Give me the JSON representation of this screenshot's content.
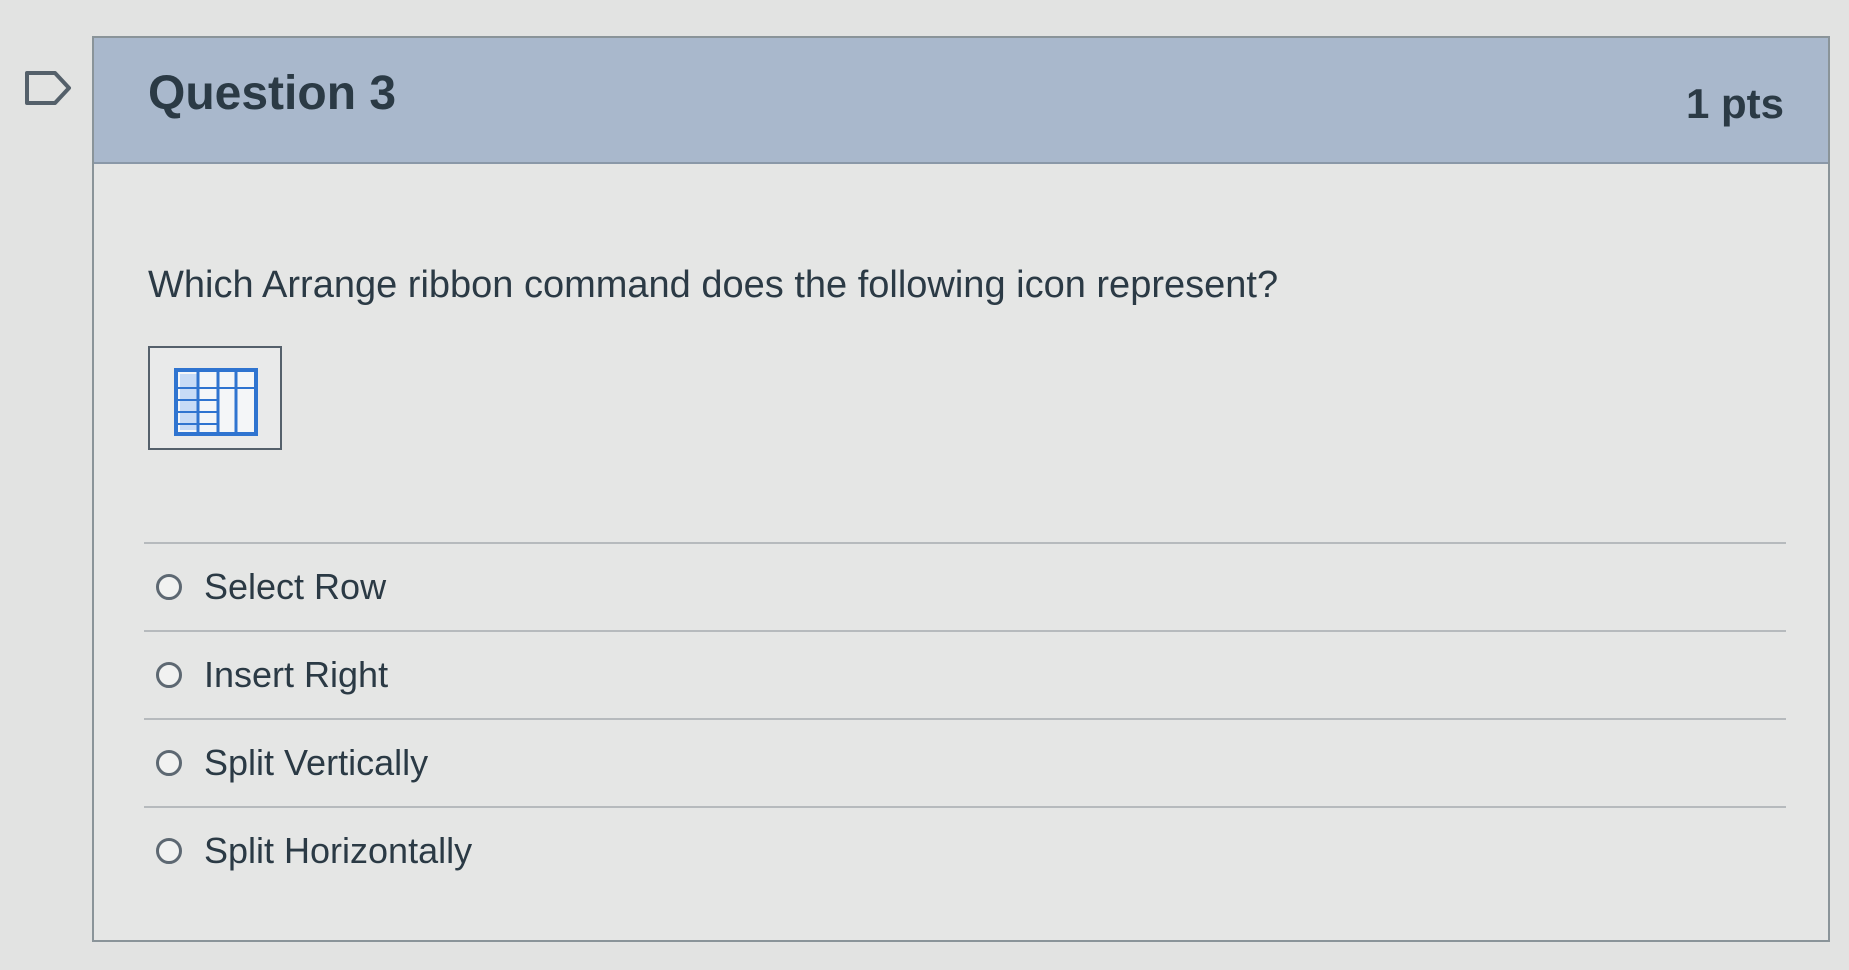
{
  "question": {
    "title": "Question 3",
    "points": "1 pts",
    "text": "Which Arrange ribbon command does the following icon represent?",
    "icon": "table-grid-icon",
    "answers": [
      {
        "label": "Select Row",
        "selected": false
      },
      {
        "label": "Insert Right",
        "selected": false
      },
      {
        "label": "Split Vertically",
        "selected": false
      },
      {
        "label": "Split Horizontally",
        "selected": false
      }
    ]
  },
  "colors": {
    "header_background": "#a9b8cc",
    "card_background": "#e5e6e5",
    "text": "#2b3a45",
    "icon_blue": "#2f74d0"
  }
}
